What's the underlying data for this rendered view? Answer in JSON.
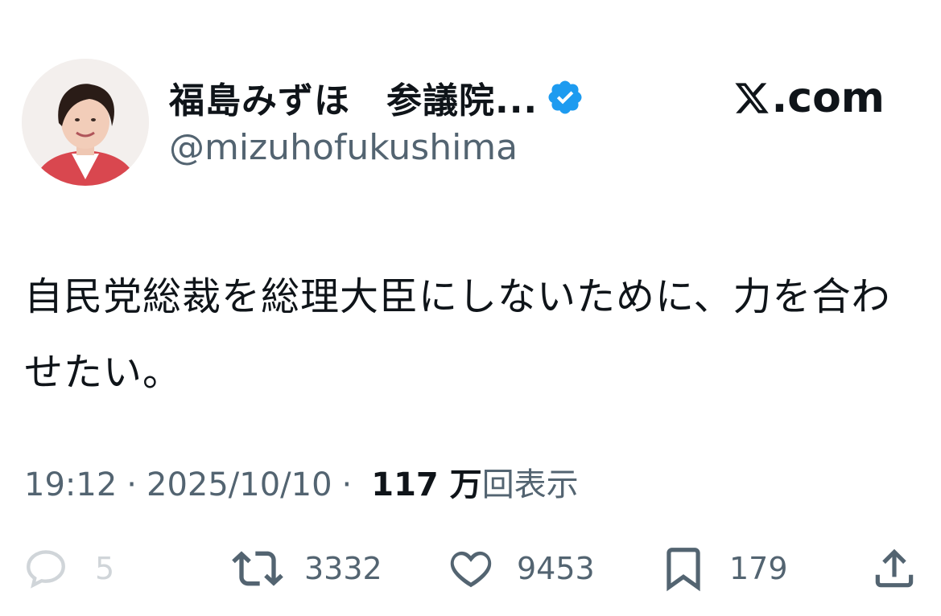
{
  "author": {
    "display_name": "福島みずほ　参議院...",
    "handle": "@mizuhofukushima",
    "verified_icon": "verified-badge-icon",
    "verified_color": "#1d9bf0"
  },
  "brand": {
    "label": ".com",
    "logo_icon": "x-logo-icon"
  },
  "tweet": {
    "text": "自民党総裁を総理大臣にしないために、力を合わせたい。"
  },
  "meta": {
    "time": "19:12",
    "separator": "·",
    "date": "2025/10/10",
    "views_count": "117 万",
    "views_label": "回表示"
  },
  "actions": {
    "reply": {
      "icon": "reply-icon",
      "count": "5"
    },
    "repost": {
      "icon": "repost-icon",
      "count": "3332"
    },
    "like": {
      "icon": "heart-icon",
      "count": "9453"
    },
    "bookmark": {
      "icon": "bookmark-icon",
      "count": "179"
    },
    "share": {
      "icon": "share-icon"
    }
  },
  "colors": {
    "text_primary": "#0f1419",
    "text_secondary": "#536471",
    "accent": "#1d9bf0"
  }
}
